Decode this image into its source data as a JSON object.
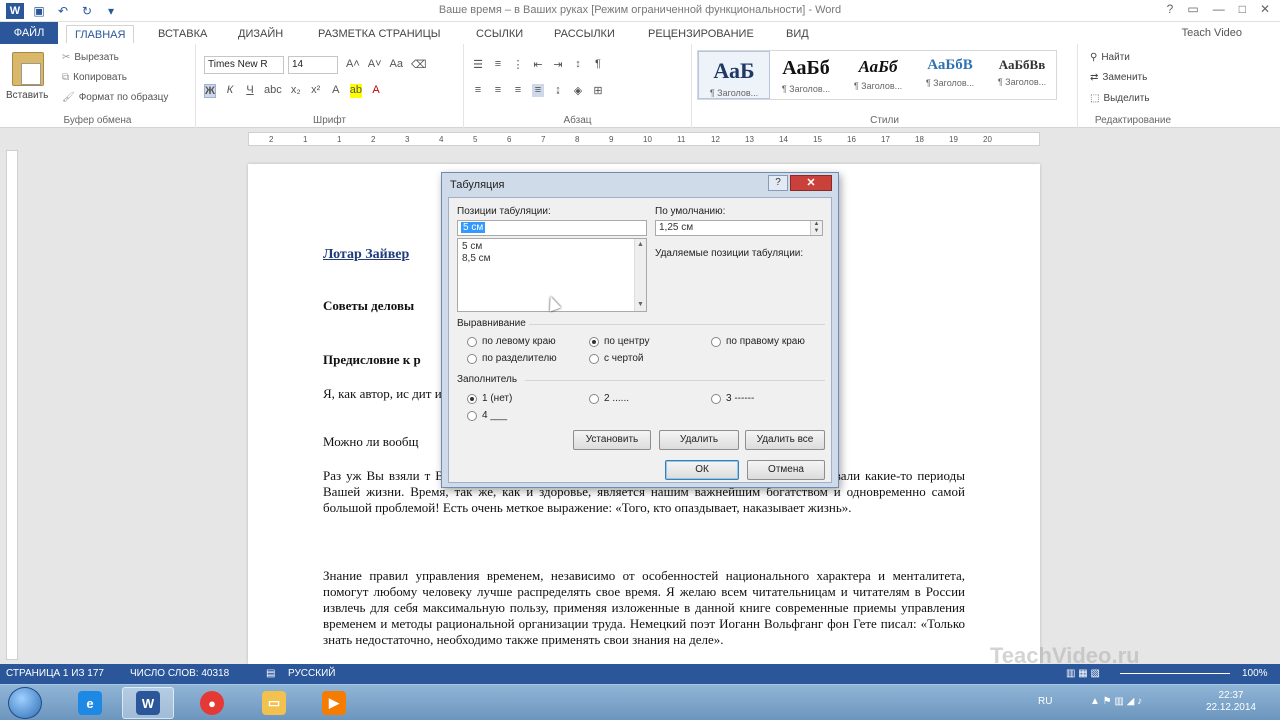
{
  "window": {
    "title": "Ваше время – в Ваших руках [Режим ограниченной функциональности] - Word",
    "user": "Teach Video"
  },
  "tabs": [
    "ФАЙЛ",
    "ГЛАВНАЯ",
    "ВСТАВКА",
    "ДИЗАЙН",
    "РАЗМЕТКА СТРАНИЦЫ",
    "ССЫЛКИ",
    "РАССЫЛКИ",
    "РЕЦЕНЗИРОВАНИЕ",
    "ВИД"
  ],
  "ribbon": {
    "clipboard": {
      "paste": "Вставить",
      "cut": "Вырезать",
      "copy": "Копировать",
      "format_painter": "Формат по образцу",
      "label": "Буфер обмена"
    },
    "font": {
      "name": "Times New R",
      "size": "14",
      "label": "Шрифт"
    },
    "paragraph": {
      "label": "Абзац"
    },
    "styles": {
      "items": [
        {
          "preview": "АаБ",
          "caption": "¶ Заголов..."
        },
        {
          "preview": "АаБб",
          "caption": "¶ Заголов..."
        },
        {
          "preview": "АаБб",
          "caption": "¶ Заголов..."
        },
        {
          "preview": "АаБбВ",
          "caption": "¶ Заголов..."
        },
        {
          "preview": "АаБбВв",
          "caption": "¶ Заголов..."
        }
      ],
      "label": "Стили"
    },
    "editing": {
      "find": "Найти",
      "replace": "Заменить",
      "select": "Выделить",
      "label": "Редактирование"
    }
  },
  "ruler": [
    "2",
    "1",
    "1",
    "2",
    "3",
    "4",
    "5",
    "6",
    "7",
    "8",
    "9",
    "10",
    "11",
    "12",
    "13",
    "14",
    "15",
    "16",
    "17",
    "18",
    "19",
    "20"
  ],
  "document": {
    "title": "Лотар Зайвер",
    "heading1": "Советы деловы",
    "heading2": "Предисловие к р",
    "p1": "Я, как автор, ис                                                    дит издание моей книги «Ваше врем",
    "p2": "Можно ли вообщ",
    "p3": "Раз уж Вы взяли                                                    т Вы в некоторой степени осознали, что с течением времени уже миновали какие-то периоды Вашей жизни. Время, так же, как и здоровье, является нашим важнейшим богатством и одновременно самой большой проблемой! Есть очень меткое выражение: «Того, кто опаздывает, наказывает жизнь».",
    "p4": "Знание правил управления временем, независимо от особенностей национального характера и менталитета, помогут любому человеку лучше распределять свое время. Я желаю всем читательницам и читателям в России извлечь для себя максимальную пользу, применяя изложенные в данной книге современные приемы управления временем и методы рациональной организации труда. Немецкий поэт Иоганн Вольфганг фон Гете писал: «Только знать недостаточно, необходимо также применять свои знания на деле»."
  },
  "dialog": {
    "title": "Табуляция",
    "tab_positions_label": "Позиции табуляции:",
    "tab_position_value": "5 см",
    "tab_list": [
      "5 см",
      "8,5 см"
    ],
    "default_label": "По умолчанию:",
    "default_value": "1,25 см",
    "removed_label": "Удаляемые позиции табуляции:",
    "alignment_label": "Выравнивание",
    "alignment": [
      {
        "label": "по левому краю",
        "checked": false
      },
      {
        "label": "по центру",
        "checked": true
      },
      {
        "label": "по правому краю",
        "checked": false
      },
      {
        "label": "по разделителю",
        "checked": false
      },
      {
        "label": "с чертой",
        "checked": false
      }
    ],
    "leader_label": "Заполнитель",
    "leader": [
      {
        "label": "1 (нет)",
        "checked": true
      },
      {
        "label": "2 ......",
        "checked": false
      },
      {
        "label": "3 ------",
        "checked": false
      },
      {
        "label": "4 ___",
        "checked": false
      }
    ],
    "buttons": {
      "set": "Установить",
      "clear": "Удалить",
      "clear_all": "Удалить все",
      "ok": "ОК",
      "cancel": "Отмена"
    }
  },
  "statusbar": {
    "page": "СТРАНИЦА 1 ИЗ 177",
    "words": "ЧИСЛО СЛОВ: 40318",
    "language": "РУССКИЙ",
    "zoom": "100%",
    "watermark": "TeachVideo.ru"
  },
  "taskbar": {
    "time": "22:37",
    "date": "22.12.2014"
  },
  "colors": {
    "accent": "#2b579a",
    "dialog_close": "#c9413a"
  }
}
